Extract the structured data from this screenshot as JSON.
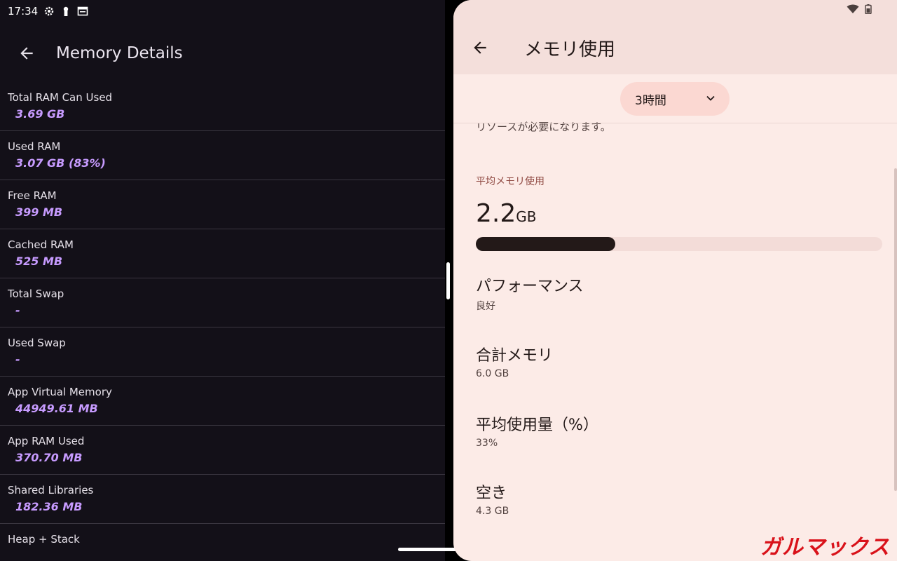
{
  "statusbar": {
    "time": "17:34"
  },
  "left": {
    "title": "Memory Details",
    "items": [
      {
        "label": "Total RAM Can Used",
        "value": "3.69 GB"
      },
      {
        "label": "Used RAM",
        "value": "3.07 GB (83%)"
      },
      {
        "label": "Free RAM",
        "value": "399 MB"
      },
      {
        "label": "Cached RAM",
        "value": "525 MB"
      },
      {
        "label": "Total Swap",
        "value": "-"
      },
      {
        "label": "Used Swap",
        "value": "-"
      },
      {
        "label": "App Virtual Memory",
        "value": "44949.61 MB"
      },
      {
        "label": "App RAM Used",
        "value": "370.70 MB"
      },
      {
        "label": "Shared Libraries",
        "value": "182.36 MB"
      },
      {
        "label": "Heap + Stack",
        "value": ""
      }
    ]
  },
  "right": {
    "title": "メモリ使用",
    "dropdown": "3時間",
    "truncated_text": "リソースが必要になります。",
    "avg_label": "平均メモリ使用",
    "avg_number": "2.2",
    "avg_unit": "GB",
    "avg_fraction": 0.343,
    "stats": [
      {
        "title": "パフォーマンス",
        "value": "良好"
      },
      {
        "title": "合計メモリ",
        "value": "6.0 GB"
      },
      {
        "title": "平均使用量（%）",
        "value": "33%"
      },
      {
        "title": "空き",
        "value": "4.3 GB"
      }
    ]
  },
  "watermark": "ガルマックス"
}
